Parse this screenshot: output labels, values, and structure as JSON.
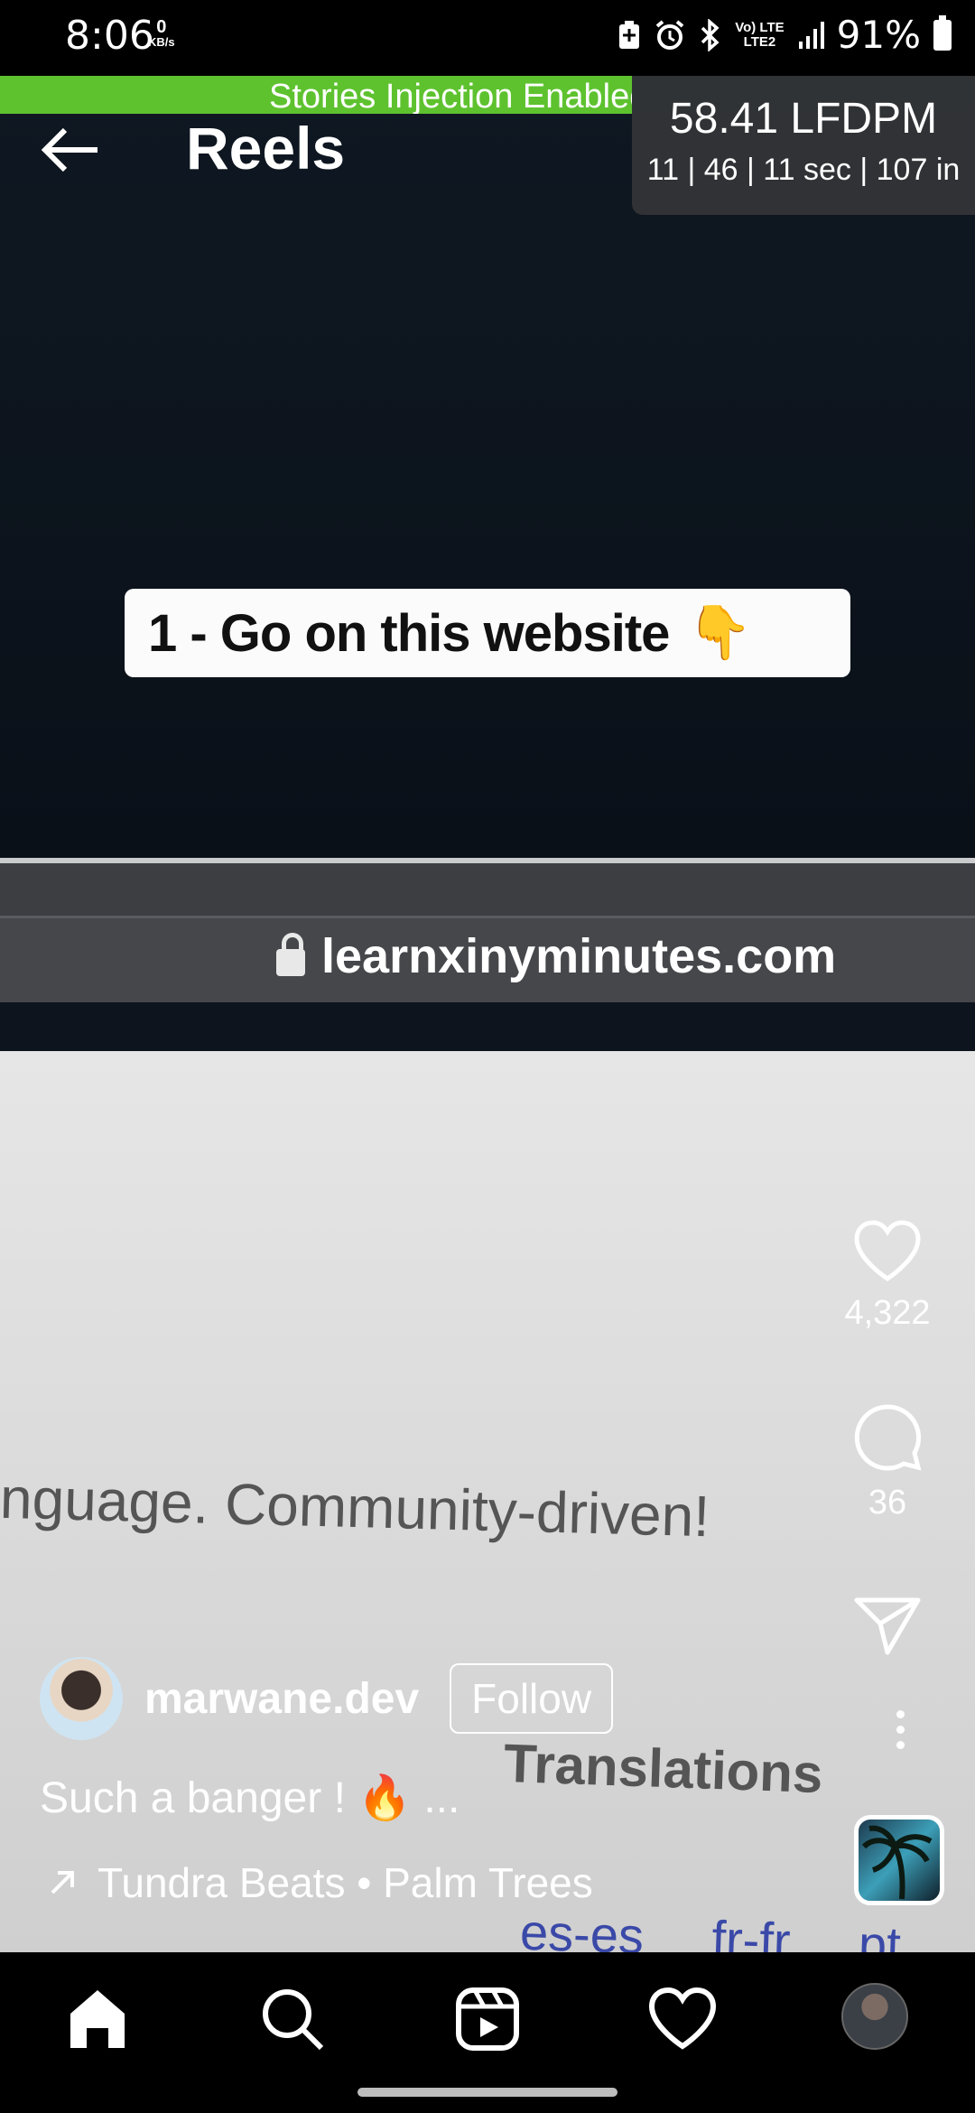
{
  "status_bar": {
    "time": "8:06",
    "data_rate_value": "0",
    "data_rate_unit": "KB/s",
    "network_top": "Vo) LTE",
    "network_bottom": "LTE2",
    "battery": "91%"
  },
  "banner": {
    "text": "Stories Injection Enabled"
  },
  "header": {
    "title": "Reels"
  },
  "perf_overlay": {
    "value": "58.41 LFDPM",
    "detail": "11 | 46 | 11 sec | 107 in"
  },
  "video": {
    "caption_text": "1 - Go on this website",
    "caption_emoji": "👇",
    "url": "learnxinyminutes.com",
    "body_text": "nguage. Community-driven!",
    "section_text": "Translations",
    "langs_text": "es-es fr-fr pt"
  },
  "actions": {
    "likes": "4,322",
    "comments": "36"
  },
  "author": {
    "username": "marwane.dev",
    "follow_label": "Follow"
  },
  "caption": {
    "text": "Such a banger ! 🔥 ..."
  },
  "audio": {
    "text": "Tundra Beats • Palm Trees"
  },
  "colors": {
    "banner": "#5ec22f",
    "background": "#000000",
    "text": "#ffffff"
  }
}
